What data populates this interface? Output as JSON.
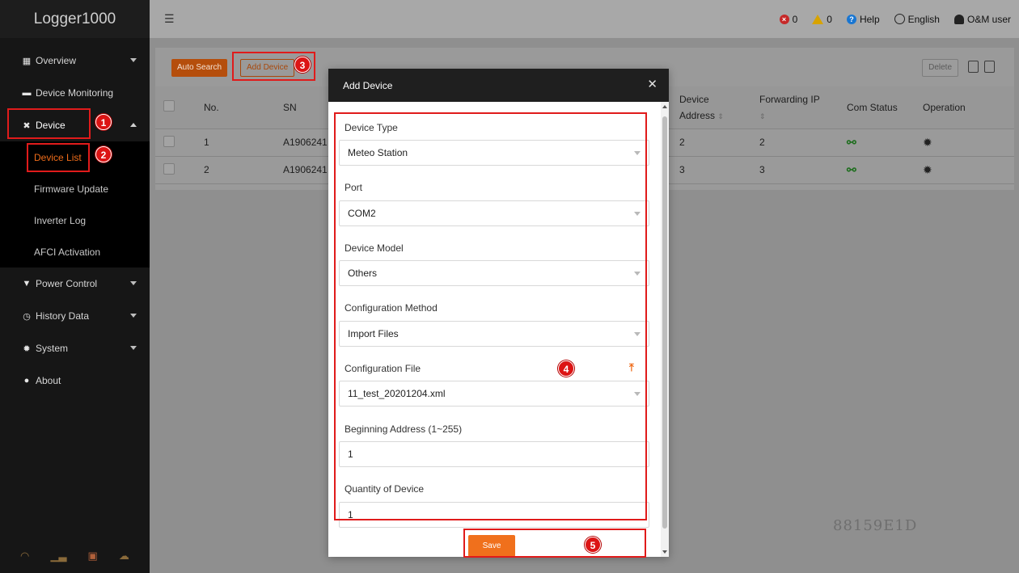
{
  "app": {
    "title": "Logger1000"
  },
  "sidebar": {
    "items": [
      {
        "label": "Overview",
        "icon": "grid-icon"
      },
      {
        "label": "Device Monitoring",
        "icon": "monitor-icon"
      },
      {
        "label": "Device",
        "icon": "tools-icon"
      },
      {
        "label": "Power Control",
        "icon": "power-control-icon"
      },
      {
        "label": "History Data",
        "icon": "history-icon"
      },
      {
        "label": "System",
        "icon": "gear-icon"
      },
      {
        "label": "About",
        "icon": "info-icon"
      }
    ],
    "device_submenu": [
      "Device List",
      "Firmware Update",
      "Inverter Log",
      "AFCI Activation"
    ]
  },
  "header": {
    "error_count": "0",
    "warning_count": "0",
    "help": "Help",
    "language": "English",
    "user": "O&M user"
  },
  "toolbar": {
    "auto_search": "Auto Search",
    "add_device": "Add Device",
    "delete": "Delete"
  },
  "table": {
    "headers": {
      "no": "No.",
      "sn": "SN",
      "device_address_1": "Device",
      "device_address_2": "Address",
      "forwarding_ip": "Forwarding IP",
      "com_status": "Com Status",
      "operation": "Operation"
    },
    "rows": [
      {
        "no": "1",
        "sn": "A1906241",
        "address": "2",
        "forwarding_ip": "2"
      },
      {
        "no": "2",
        "sn": "A1906241",
        "address": "3",
        "forwarding_ip": "3"
      }
    ]
  },
  "modal": {
    "title": "Add Device",
    "fields": {
      "device_type": {
        "label": "Device Type",
        "value": "Meteo Station"
      },
      "port": {
        "label": "Port",
        "value": "COM2"
      },
      "device_model": {
        "label": "Device Model",
        "value": "Others"
      },
      "config_method": {
        "label": "Configuration Method",
        "value": "Import Files"
      },
      "config_file": {
        "label": "Configuration File",
        "value": "11_test_20201204.xml"
      },
      "beginning_address": {
        "label": "Beginning Address (1~255)",
        "value": "1"
      },
      "quantity": {
        "label": "Quantity of Device",
        "value": "1"
      }
    },
    "save": "Save"
  },
  "watermark": "88159E1D",
  "annotations": [
    "1",
    "2",
    "3",
    "4",
    "5"
  ],
  "colors": {
    "accent": "#f0701c",
    "highlight": "#e01b1b",
    "sidebar": "#161616"
  }
}
